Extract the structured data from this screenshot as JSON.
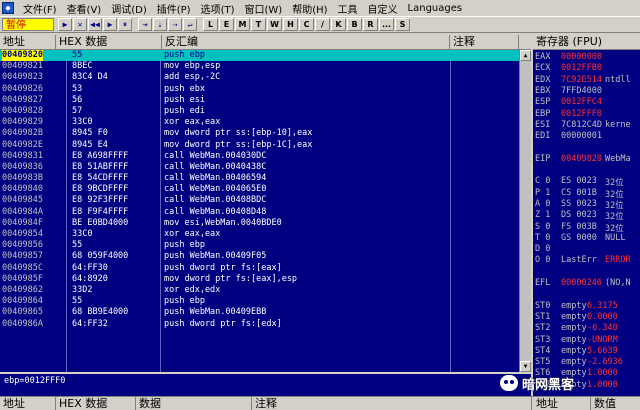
{
  "menu": {
    "app_icon": "ollydbg-icon",
    "items": [
      "文件(F)",
      "查看(V)",
      "调试(D)",
      "插件(P)",
      "选项(T)",
      "窗口(W)",
      "帮助(H)",
      "工具",
      "自定义",
      "Languages"
    ]
  },
  "toolbar": {
    "status": "暂停",
    "buttons": [
      "▶",
      "✕",
      "◀◀",
      "▶",
      "⏸",
      "⇥",
      "⇣",
      "⇢",
      "↵"
    ],
    "letters": [
      "L",
      "E",
      "M",
      "T",
      "W",
      "H",
      "C",
      "/",
      "K",
      "B",
      "R",
      "...",
      "S"
    ]
  },
  "cpu_header": {
    "address": "地址",
    "hex": "HEX 数据",
    "disasm": "反汇编",
    "comment": "注释"
  },
  "rows": [
    {
      "addr": "00409820",
      "hex": "55",
      "dis": "push ebp"
    },
    {
      "addr": "00409821",
      "hex": "8BEC",
      "dis": "mov ebp,esp"
    },
    {
      "addr": "00409823",
      "hex": "83C4 D4",
      "dis": "add esp,-2C"
    },
    {
      "addr": "00409826",
      "hex": "53",
      "dis": "push ebx"
    },
    {
      "addr": "00409827",
      "hex": "56",
      "dis": "push esi"
    },
    {
      "addr": "00409828",
      "hex": "57",
      "dis": "push edi"
    },
    {
      "addr": "00409829",
      "hex": "33C0",
      "dis": "xor eax,eax"
    },
    {
      "addr": "0040982B",
      "hex": "8945 F0",
      "dis": "mov dword ptr ss:[ebp-10],eax"
    },
    {
      "addr": "0040982E",
      "hex": "8945 E4",
      "dis": "mov dword ptr ss:[ebp-1C],eax"
    },
    {
      "addr": "00409831",
      "hex": "E8 A698FFFF",
      "dis": "call WebMan.004030DC"
    },
    {
      "addr": "00409836",
      "hex": "E8 51ABFFFF",
      "dis": "call WebMan.0040438C"
    },
    {
      "addr": "0040983B",
      "hex": "E8 54CDFFFF",
      "dis": "call WebMan.00406594"
    },
    {
      "addr": "00409840",
      "hex": "E8 9BCDFFFF",
      "dis": "call WebMan.004065E0"
    },
    {
      "addr": "00409845",
      "hex": "E8 92F3FFFF",
      "dis": "call WebMan.00408BDC"
    },
    {
      "addr": "0040984A",
      "hex": "E8 F9F4FFFF",
      "dis": "call WebMan.00408D48"
    },
    {
      "addr": "0040984F",
      "hex": "BE E0BD4000",
      "dis": "mov esi,WebMan.0040BDE0"
    },
    {
      "addr": "00409854",
      "hex": "33C0",
      "dis": "xor eax,eax"
    },
    {
      "addr": "00409856",
      "hex": "55",
      "dis": "push ebp"
    },
    {
      "addr": "00409857",
      "hex": "68 059F4000",
      "dis": "push WebMan.00409F05"
    },
    {
      "addr": "0040985C",
      "hex": "64:FF30",
      "dis": "push dword ptr fs:[eax]"
    },
    {
      "addr": "0040985F",
      "hex": "64:8920",
      "dis": "mov dword ptr fs:[eax],esp"
    },
    {
      "addr": "00409862",
      "hex": "33D2",
      "dis": "xor edx,edx"
    },
    {
      "addr": "00409864",
      "hex": "55",
      "dis": "push ebp"
    },
    {
      "addr": "00409865",
      "hex": "68 BB9E4000",
      "dis": "push WebMan.00409EBB"
    },
    {
      "addr": "0040986A",
      "hex": "64:FF32",
      "dis": "push dword ptr fs:[edx]"
    }
  ],
  "registers": {
    "title": "寄存器 (FPU)",
    "lines": [
      {
        "n": "EAX",
        "v": "00000000",
        "x": "",
        "c": "r"
      },
      {
        "n": "ECX",
        "v": "0012FFB0",
        "x": "",
        "c": "r"
      },
      {
        "n": "EDX",
        "v": "7C92E514",
        "x": "ntdll",
        "c": "r"
      },
      {
        "n": "EBX",
        "v": "7FFD4000",
        "x": "",
        "c": "w"
      },
      {
        "n": "ESP",
        "v": "0012FFC4",
        "x": "",
        "c": "r"
      },
      {
        "n": "EBP",
        "v": "0012FFF0",
        "x": "",
        "c": "r"
      },
      {
        "n": "ESI",
        "v": "7C812C4D",
        "x": "kerne",
        "c": "w"
      },
      {
        "n": "EDI",
        "v": "00000001",
        "x": "",
        "c": "w"
      },
      {
        "n": "",
        "v": "",
        "x": "",
        "c": "w"
      },
      {
        "n": "EIP",
        "v": "00409820",
        "x": "WebMa",
        "c": "r"
      },
      {
        "n": "",
        "v": "",
        "x": "",
        "c": "w"
      },
      {
        "n": "C 0",
        "v": "ES 0023",
        "x": "32位",
        "c": "w"
      },
      {
        "n": "P 1",
        "v": "CS 001B",
        "x": "32位",
        "c": "w"
      },
      {
        "n": "A 0",
        "v": "SS 0023",
        "x": "32位",
        "c": "w"
      },
      {
        "n": "Z 1",
        "v": "DS 0023",
        "x": "32位",
        "c": "w"
      },
      {
        "n": "S 0",
        "v": "FS 003B",
        "x": "32位",
        "c": "w"
      },
      {
        "n": "T 0",
        "v": "GS 0000",
        "x": "NULL",
        "c": "w"
      },
      {
        "n": "D 0",
        "v": "",
        "x": "",
        "c": "w"
      },
      {
        "n": "O 0",
        "v": "LastErr",
        "x": "ERROR",
        "c": "w"
      },
      {
        "n": "",
        "v": "",
        "x": "",
        "c": "w"
      },
      {
        "n": "EFL",
        "v": "00000246",
        "x": "(NO,N",
        "c": "r"
      },
      {
        "n": "",
        "v": "",
        "x": "",
        "c": "w"
      },
      {
        "n": "ST0",
        "v": "empty",
        "x": "6.3175",
        "c": "w"
      },
      {
        "n": "ST1",
        "v": "empty",
        "x": "0.0000",
        "c": "w"
      },
      {
        "n": "ST2",
        "v": "empty",
        "x": "-6.340",
        "c": "w"
      },
      {
        "n": "ST3",
        "v": "empty",
        "x": "-UNORM",
        "c": "w"
      },
      {
        "n": "ST4",
        "v": "empty",
        "x": "5.6639",
        "c": "w"
      },
      {
        "n": "ST5",
        "v": "empty",
        "x": "-2.6936",
        "c": "w"
      },
      {
        "n": "ST6",
        "v": "empty",
        "x": "1.0000",
        "c": "w"
      },
      {
        "n": "ST7",
        "v": "empty",
        "x": "1.0000",
        "c": "w"
      }
    ]
  },
  "info_text": "ebp=0012FFF0",
  "dump_header": {
    "address": "地址",
    "hex": "HEX 数据",
    "ascii": "数据",
    "comment": "注释",
    "stack_addr": "地址",
    "stack_val": "数值"
  },
  "watermark": "暗网黑客"
}
